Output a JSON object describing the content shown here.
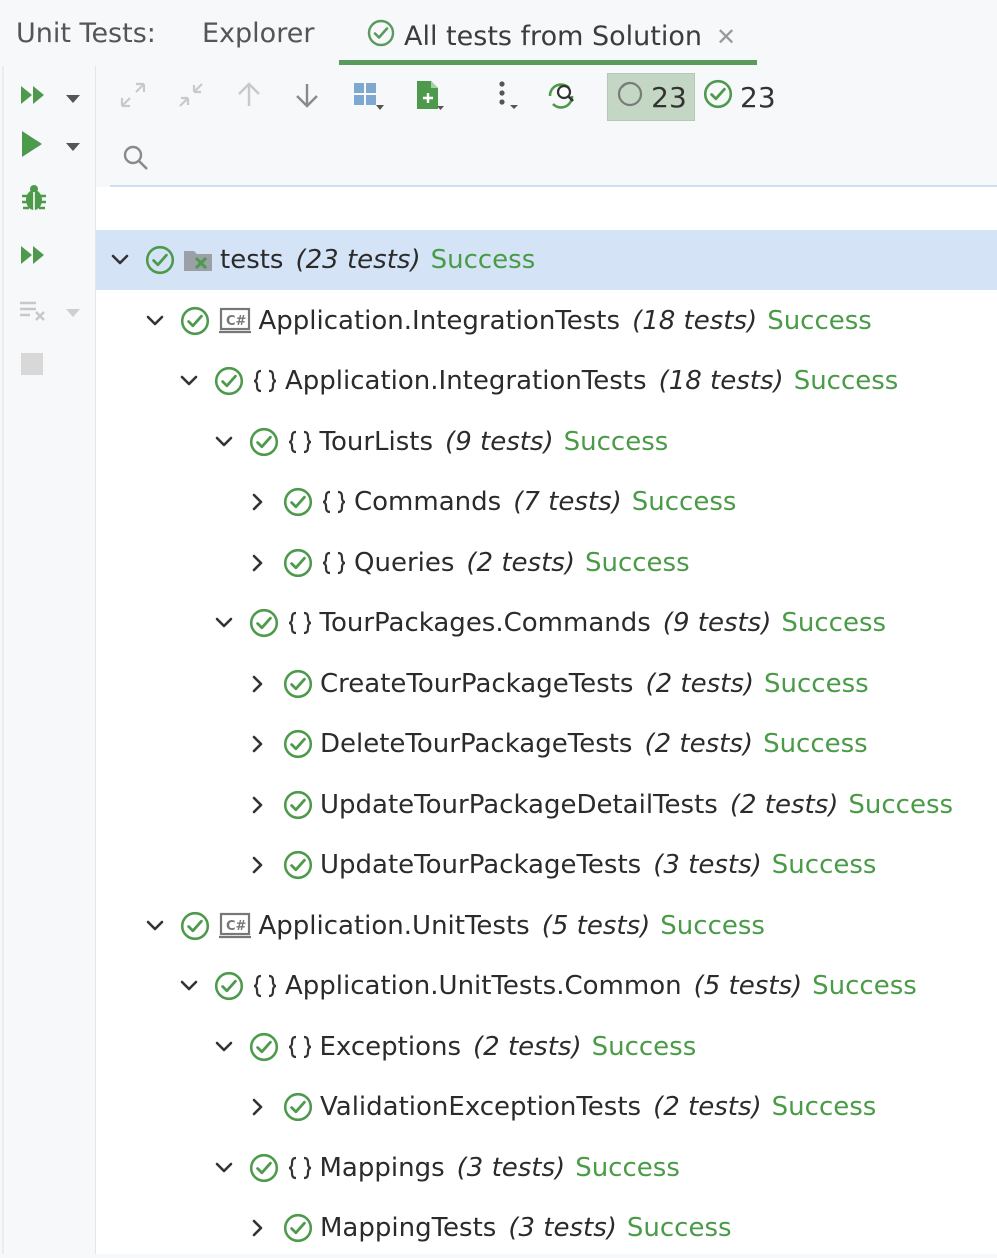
{
  "header": {
    "label": "Unit Tests:",
    "tabs": [
      {
        "label": "Explorer",
        "active": false
      },
      {
        "label": "All tests from Solution",
        "active": true
      }
    ]
  },
  "toolbar": {
    "total_count": "23",
    "passed_count": "23"
  },
  "search": {
    "placeholder": "",
    "value": ""
  },
  "colors": {
    "success": "#4a9b48",
    "selected_row": "#d4e3f6",
    "accent": "#5a9a5c"
  },
  "tree": [
    {
      "name": "tests",
      "count": "(23 tests)",
      "status": "Success",
      "expanded": true,
      "icon": "folder-icon"
    },
    {
      "name": "Application.IntegrationTests",
      "count": "(18 tests)",
      "status": "Success",
      "expanded": true,
      "icon": "csharp-project-icon"
    },
    {
      "name": "Application.IntegrationTests",
      "count": "(18 tests)",
      "status": "Success",
      "expanded": true,
      "icon": "namespace-icon"
    },
    {
      "name": "TourLists",
      "count": "(9 tests)",
      "status": "Success",
      "expanded": true,
      "icon": "namespace-icon"
    },
    {
      "name": "Commands",
      "count": "(7 tests)",
      "status": "Success",
      "expanded": false,
      "icon": "namespace-icon"
    },
    {
      "name": "Queries",
      "count": "(2 tests)",
      "status": "Success",
      "expanded": false,
      "icon": "namespace-icon"
    },
    {
      "name": "TourPackages.Commands",
      "count": "(9 tests)",
      "status": "Success",
      "expanded": true,
      "icon": "namespace-icon"
    },
    {
      "name": "CreateTourPackageTests",
      "count": "(2 tests)",
      "status": "Success",
      "expanded": false,
      "icon": "none"
    },
    {
      "name": "DeleteTourPackageTests",
      "count": "(2 tests)",
      "status": "Success",
      "expanded": false,
      "icon": "none"
    },
    {
      "name": "UpdateTourPackageDetailTests",
      "count": "(2 tests)",
      "status": "Success",
      "expanded": false,
      "icon": "none"
    },
    {
      "name": "UpdateTourPackageTests",
      "count": "(3 tests)",
      "status": "Success",
      "expanded": false,
      "icon": "none"
    },
    {
      "name": "Application.UnitTests",
      "count": "(5 tests)",
      "status": "Success",
      "expanded": true,
      "icon": "csharp-project-icon"
    },
    {
      "name": "Application.UnitTests.Common",
      "count": "(5 tests)",
      "status": "Success",
      "expanded": true,
      "icon": "namespace-icon"
    },
    {
      "name": "Exceptions",
      "count": "(2 tests)",
      "status": "Success",
      "expanded": true,
      "icon": "namespace-icon"
    },
    {
      "name": "ValidationExceptionTests",
      "count": "(2 tests)",
      "status": "Success",
      "expanded": false,
      "icon": "none"
    },
    {
      "name": "Mappings",
      "count": "(3 tests)",
      "status": "Success",
      "expanded": true,
      "icon": "namespace-icon"
    },
    {
      "name": "MappingTests",
      "count": "(3 tests)",
      "status": "Success",
      "expanded": false,
      "icon": "none"
    }
  ]
}
